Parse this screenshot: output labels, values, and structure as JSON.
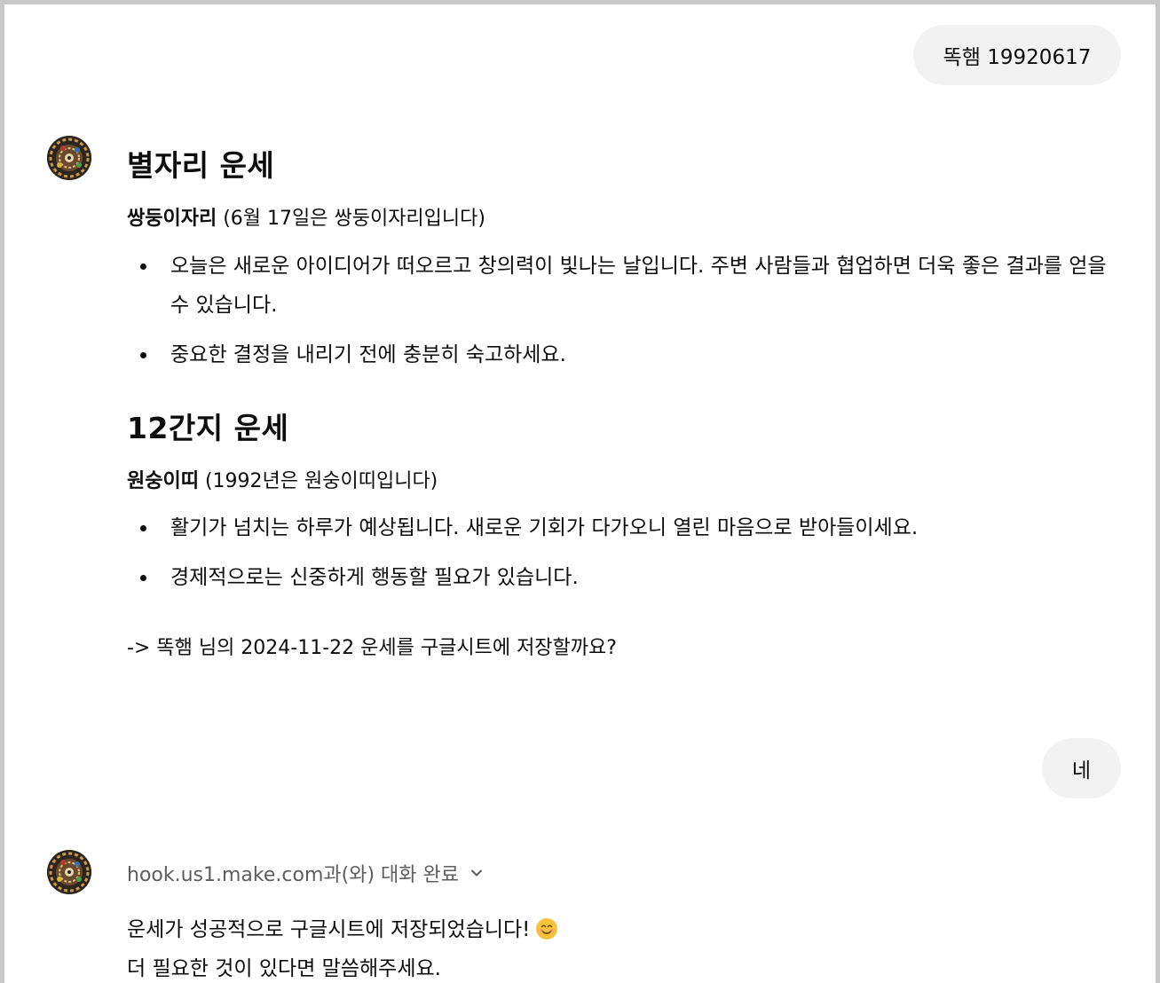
{
  "conversation": {
    "user_message_1": "똑햄 19920617",
    "assistant_1": {
      "horoscope_heading": "별자리 운세",
      "horoscope_sign_bold": "쌍둥이자리",
      "horoscope_sign_note": " (6월 17일은 쌍둥이자리입니다)",
      "horoscope_bullets": [
        "오늘은 새로운 아이디어가 떠오르고 창의력이 빛나는 날입니다. 주변 사람들과 협업하면 더욱 좋은 결과를 얻을 수 있습니다.",
        "중요한 결정을 내리기 전에 충분히 숙고하세요."
      ],
      "zodiac_heading": "12간지 운세",
      "zodiac_sign_bold": "원숭이띠",
      "zodiac_sign_note": " (1992년은 원숭이띠입니다)",
      "zodiac_bullets": [
        "활기가 넘치는 하루가 예상됩니다. 새로운 기회가 다가오니 열린 마음으로 받아들이세요.",
        "경제적으로는 신중하게 행동할 필요가 있습니다."
      ],
      "save_prompt": "-> 똑햄 님의 2024-11-22 운세를 구글시트에 저장할까요?"
    },
    "user_message_2": "네",
    "assistant_2": {
      "tool_status": "hook.us1.make.com과(와) 대화 완료",
      "reply_line_1": "운세가 성공적으로 구글시트에 저장되었습니다!",
      "reply_line_2": "더 필요한 것이 있다면 말씀해주세요."
    }
  },
  "icons": {
    "avatar": "assistant-avatar-icon",
    "chevron": "chevron-down-icon",
    "emoji": "smiling-face-emoji"
  },
  "colors": {
    "user_bubble_bg": "#f2f2f2",
    "status_text": "#5d5d5d",
    "text": "#0d0d0d"
  }
}
